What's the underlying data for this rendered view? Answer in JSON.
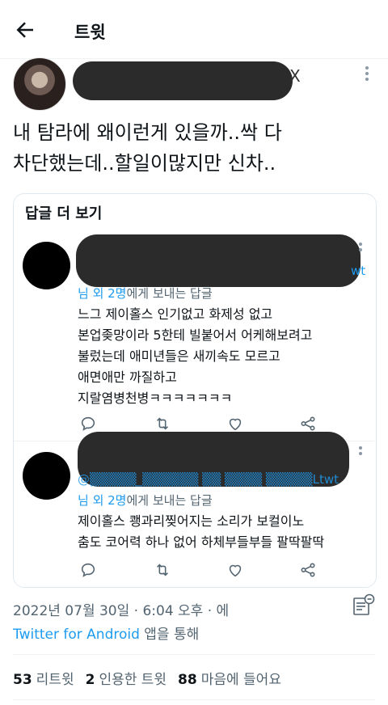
{
  "header": {
    "title": "트윗",
    "back_icon": "arrow-left-icon"
  },
  "tweet": {
    "text": "내 탐라에 왜이런게 있을까..싹 다\n차단했는데..할일이많지만 신차..",
    "redaction_tail": "X"
  },
  "replies_card": {
    "title": "답글 더 보기",
    "replies": [
      {
        "handle_tail": "wt",
        "reply_to_prefix": "님 외 2명",
        "reply_to_suffix": "에게 보내는 답글",
        "text": "느그 제이홀스 인기없고 화제성 없고\n본업좆망이라  5한테 빌붙어서 어케해보려고\n불렀는데 애미년들은 새끼속도 모르고\n애면애만 까질하고\n지랄염병천병ㅋㅋㅋㅋㅋㅋㅋ"
      },
      {
        "handle_tail": "@▒▒▒▒▒_▒▒▒▒▒▒ ▒▒ ▒▒▒▒ ▒▒▒▒▒Ltwt",
        "reply_to_prefix": "님 외 2명",
        "reply_to_suffix": "에게 보내는 답글",
        "text": "제이홀스 쾡과리찢어지는 소리가 보컬이노\n춤도 코어력 하나 없어 하체부들부들 팔딱팔딱"
      }
    ]
  },
  "meta": {
    "timestamp": "2022년 07월 30일 · 6:04 오후 · 에",
    "source": "Twitter for Android",
    "source_suffix": " 앱을 통해"
  },
  "stats": {
    "retweets_count": "53",
    "retweets_label": "리트윗",
    "quotes_count": "2",
    "quotes_label": "인용한 트윗",
    "likes_count": "88",
    "likes_label": "마음에 들어요"
  },
  "colors": {
    "accent": "#1d9bf0",
    "text": "#0f1419",
    "muted": "#536471",
    "border": "#e1e8ed"
  }
}
